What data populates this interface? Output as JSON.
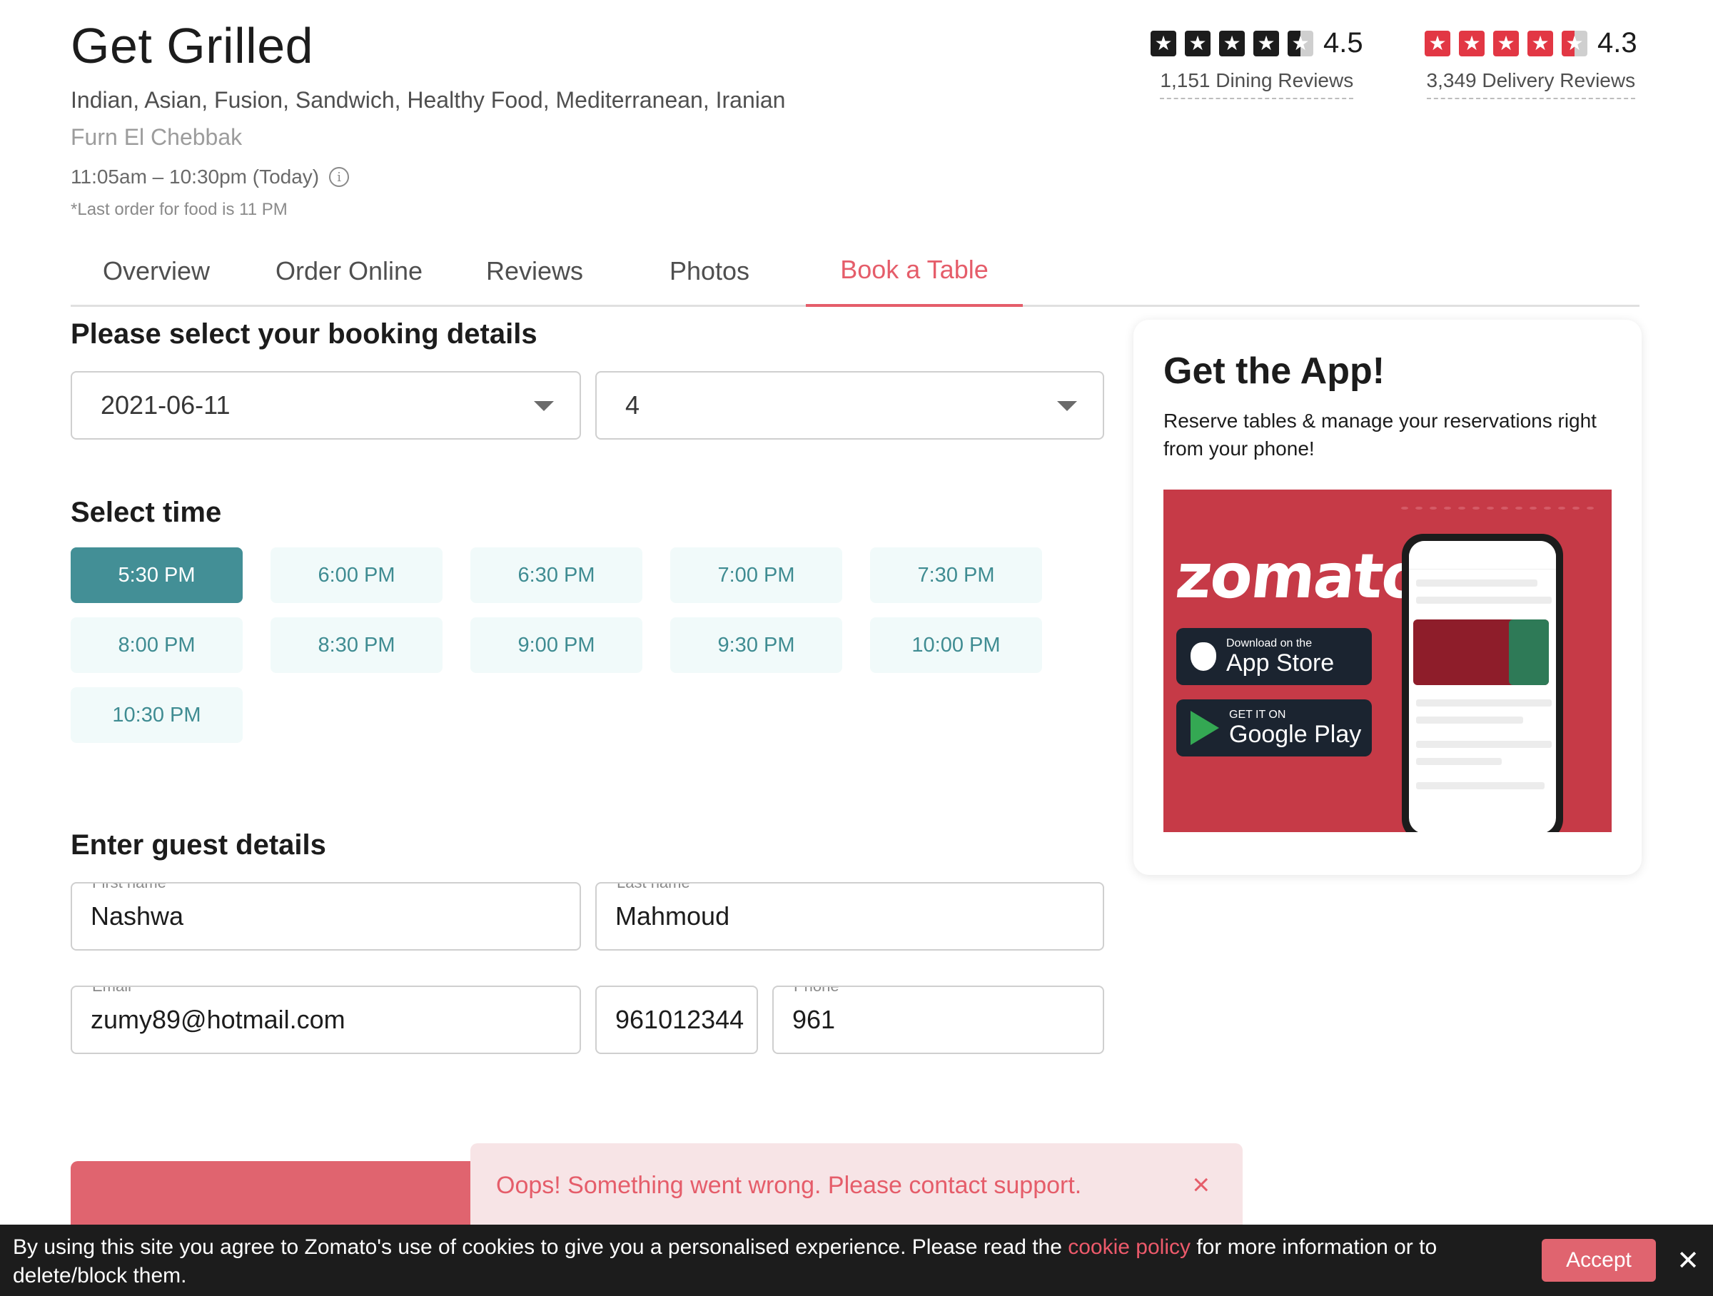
{
  "restaurant": {
    "name": "Get Grilled",
    "cuisines": "Indian, Asian, Fusion, Sandwich, Healthy Food, Mediterranean, Iranian",
    "locality": "Furn El Chebbak",
    "hours": "11:05am – 10:30pm (Today)",
    "last_order": "*Last order for food is 11 PM"
  },
  "ratings": {
    "dining": {
      "value": "4.5",
      "label": "1,151 Dining Reviews",
      "star_color": "#1c1c1c"
    },
    "delivery": {
      "value": "4.3",
      "label": "3,349 Delivery Reviews",
      "star_color": "#e23744"
    }
  },
  "tabs": [
    {
      "label": "Overview",
      "active": false
    },
    {
      "label": "Order Online",
      "active": false
    },
    {
      "label": "Reviews",
      "active": false
    },
    {
      "label": "Photos",
      "active": false
    },
    {
      "label": "Book a Table",
      "active": true
    }
  ],
  "booking": {
    "heading": "Please select your booking details",
    "date": "2021-06-11",
    "guests": "4",
    "time_heading": "Select time",
    "selected_time": "5:30 PM",
    "times": [
      "5:30 PM",
      "6:00 PM",
      "6:30 PM",
      "7:00 PM",
      "7:30 PM",
      "8:00 PM",
      "8:30 PM",
      "9:00 PM",
      "9:30 PM",
      "10:00 PM",
      "10:30 PM"
    ]
  },
  "guest": {
    "heading": "Enter guest details",
    "first_name_label": "First name",
    "first_name": "Nashwa",
    "last_name_label": "Last name",
    "last_name": "Mahmoud",
    "email_label": "Email",
    "email": "zumy89@hotmail.com",
    "country_code": "961012344",
    "phone_label": "Phone",
    "phone": "961"
  },
  "toast": {
    "message": "Oops! Something went wrong. Please contact support.",
    "close": "×"
  },
  "app_card": {
    "title": "Get the App!",
    "text": "Reserve tables & manage your reservations right from your phone!",
    "brand": "zomato",
    "app_store_small": "Download on the",
    "app_store_big": "App Store",
    "google_small": "GET IT ON",
    "google_big": "Google Play"
  },
  "cookie": {
    "text_before": "By using this site you agree to Zomato's use of cookies to give you a personalised experience. Please read the ",
    "link": "cookie policy",
    "text_after": " for more information or to delete/block them.",
    "accept": "Accept",
    "close": "✕"
  },
  "colors": {
    "accent": "#e55d6a",
    "teal": "#438f96",
    "teal_light_bg": "#f1fafa"
  }
}
